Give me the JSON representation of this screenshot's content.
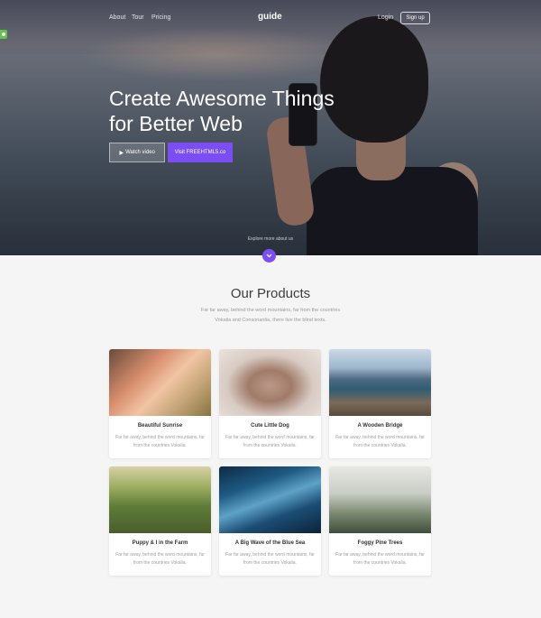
{
  "nav": {
    "links": [
      "About",
      "Tour",
      "Pricing"
    ],
    "brand": "guide",
    "login": "Login",
    "signup": "Sign up"
  },
  "hero": {
    "title_line1": "Create Awesome Things",
    "title_line2": "for Better Web",
    "watch_label": "Watch video",
    "visit_label": "Visit FREEHTML5.co",
    "explore": "Explore more about us"
  },
  "products": {
    "title": "Our Products",
    "subtitle_line1": "Far far away, behind the word mountains, far from the countries",
    "subtitle_line2": "Vokalia and Consonantia, there live the blind texts.",
    "items": [
      {
        "title": "Beautiful Sunrise",
        "desc": "Far far away, behind the word mountains, far from the countries Vokalia."
      },
      {
        "title": "Cute Little Dog",
        "desc": "Far far away, behind the word mountains, far from the countries Vokalia."
      },
      {
        "title": "A Wooden Bridge",
        "desc": "Far far away, behind the word mountains, far from the countries Vokalia."
      },
      {
        "title": "Puppy & I in the Farm",
        "desc": "Far far away, behind the word mountains, far from the countries Vokalia."
      },
      {
        "title": "A Big Wave of the Blue Sea",
        "desc": "Far far away, behind the word mountains, far from the countries Vokalia."
      },
      {
        "title": "Foggy Pine Trees",
        "desc": "Far far away, behind the word mountains, far from the countries Vokalia."
      }
    ]
  },
  "colors": {
    "accent": "#7a4ef2",
    "page_bg": "#f5f5f5"
  },
  "icons": {
    "play": "play-icon",
    "down": "chevron-down-icon"
  }
}
